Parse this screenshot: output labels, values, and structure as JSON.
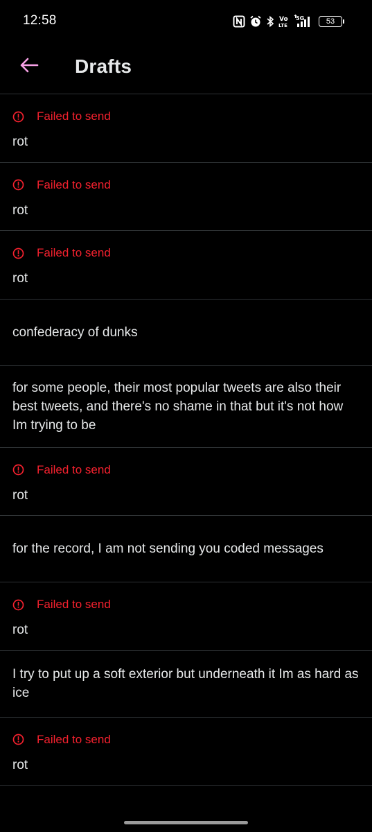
{
  "status_bar": {
    "time": "12:58",
    "battery_level": "53",
    "icons": [
      "nfc-icon",
      "alarm-icon",
      "bluetooth-icon",
      "volte-icon",
      "5g-signal-icon",
      "battery-icon"
    ]
  },
  "header": {
    "title": "Drafts",
    "back_icon": "arrow-left-icon",
    "accent_color": "#f7a1e6"
  },
  "colors": {
    "error": "#f4212e",
    "divider": "#2f3336",
    "text": "#e7e9ea",
    "background": "#000000"
  },
  "drafts": [
    {
      "status": "Failed to send",
      "text": "rot"
    },
    {
      "status": "Failed to send",
      "text": "rot"
    },
    {
      "status": "Failed to send",
      "text": "rot"
    },
    {
      "status": "",
      "text": "confederacy of dunks"
    },
    {
      "status": "",
      "text": "for some people, their most popular tweets are also their best tweets, and there's no shame in that but it's not how Im trying to be"
    },
    {
      "status": "Failed to send",
      "text": "rot"
    },
    {
      "status": "",
      "text": "for the record, I am not sending you coded messages"
    },
    {
      "status": "Failed to send",
      "text": "rot"
    },
    {
      "status": "",
      "text": "I try to put up a soft exterior but underneath it Im as hard as ice"
    },
    {
      "status": "Failed to send",
      "text": "rot"
    }
  ]
}
